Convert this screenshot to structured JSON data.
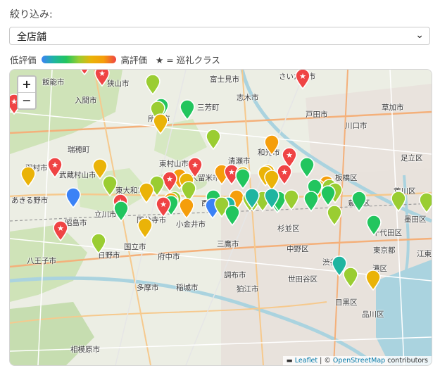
{
  "filter": {
    "label": "絞り込み:",
    "selected": "全店舗"
  },
  "legend": {
    "low": "低評価",
    "high": "高評価",
    "star_note": "★ = 巡礼クラス"
  },
  "map": {
    "zoom_in": "+",
    "zoom_out": "−",
    "attribution": {
      "leaflet": "Leaflet",
      "sep": " | © ",
      "osm": "OpenStreetMap",
      "contrib": " contributors"
    },
    "places": [
      {
        "name": "さいたま市"
      },
      {
        "name": "富士見市"
      },
      {
        "name": "志木市"
      },
      {
        "name": "飯能市"
      },
      {
        "name": "狭山市"
      },
      {
        "name": "入間市"
      },
      {
        "name": "三芳町"
      },
      {
        "name": "戸田市"
      },
      {
        "name": "草加市"
      },
      {
        "name": "川口市"
      },
      {
        "name": "所沢市"
      },
      {
        "name": "和光市"
      },
      {
        "name": "足立区"
      },
      {
        "name": "東村山市"
      },
      {
        "name": "瑞穂町"
      },
      {
        "name": "羽村市"
      },
      {
        "name": "清瀬市"
      },
      {
        "name": "武蔵村山市"
      },
      {
        "name": "東久留米市"
      },
      {
        "name": "板橋区"
      },
      {
        "name": "荒川区"
      },
      {
        "name": "東大和市"
      },
      {
        "name": "西東京市"
      },
      {
        "name": "あきる野市"
      },
      {
        "name": "豊島区"
      },
      {
        "name": "墨田区"
      },
      {
        "name": "立川市"
      },
      {
        "name": "国分寺市"
      },
      {
        "name": "小金井市"
      },
      {
        "name": "杉並区"
      },
      {
        "name": "千代田区"
      },
      {
        "name": "昭島市"
      },
      {
        "name": "国立市"
      },
      {
        "name": "三鷹市"
      },
      {
        "name": "東京都"
      },
      {
        "name": "江東区"
      },
      {
        "name": "八王子市"
      },
      {
        "name": "日野市"
      },
      {
        "name": "府中市"
      },
      {
        "name": "渋谷区"
      },
      {
        "name": "港区"
      },
      {
        "name": "調布市"
      },
      {
        "name": "世田谷区"
      },
      {
        "name": "多摩市"
      },
      {
        "name": "稲城市"
      },
      {
        "name": "狛江市"
      },
      {
        "name": "品川区"
      },
      {
        "name": "目黒区"
      },
      {
        "name": "相模原市"
      },
      {
        "name": "中野区"
      }
    ],
    "markers": [
      {
        "color": "#eab308",
        "star": false
      },
      {
        "color": "#ef4444",
        "star": true
      },
      {
        "color": "#9acd32",
        "star": false
      },
      {
        "color": "#ef4444",
        "star": true
      },
      {
        "color": "#ef4444",
        "star": true
      },
      {
        "color": "#9acd32",
        "star": false
      },
      {
        "color": "#ef4444",
        "star": true
      },
      {
        "color": "#22c55e",
        "star": false
      },
      {
        "color": "#9acd32",
        "star": false
      },
      {
        "color": "#eab308",
        "star": false
      },
      {
        "color": "#22c55e",
        "star": false
      },
      {
        "color": "#9acd32",
        "star": false
      },
      {
        "color": "#f59e0b",
        "star": false
      },
      {
        "color": "#ef4444",
        "star": true
      },
      {
        "color": "#eab308",
        "star": false
      },
      {
        "color": "#ef4444",
        "star": true
      },
      {
        "color": "#f59e0b",
        "star": false
      },
      {
        "color": "#ef4444",
        "star": true
      },
      {
        "color": "#eab308",
        "star": false
      },
      {
        "color": "#eab308",
        "star": false
      },
      {
        "color": "#eab308",
        "star": false
      },
      {
        "color": "#ef4444",
        "star": true
      },
      {
        "color": "#22c55e",
        "star": false
      },
      {
        "color": "#f59e0b",
        "star": false
      },
      {
        "color": "#ef4444",
        "star": true
      },
      {
        "color": "#eab308",
        "star": false
      },
      {
        "color": "#ef4444",
        "star": true
      },
      {
        "color": "#eab308",
        "star": false
      },
      {
        "color": "#9acd32",
        "star": false
      },
      {
        "color": "#9acd32",
        "star": false
      },
      {
        "color": "#f59e0b",
        "star": false
      },
      {
        "color": "#22c55e",
        "star": false
      },
      {
        "color": "#f59e0b",
        "star": false
      },
      {
        "color": "#eab308",
        "star": false
      },
      {
        "color": "#9acd32",
        "star": false
      },
      {
        "color": "#eab308",
        "star": false
      },
      {
        "color": "#9acd32",
        "star": false
      },
      {
        "color": "#3b82f6",
        "star": false
      },
      {
        "color": "#ef4444",
        "star": true
      },
      {
        "color": "#9acd32",
        "star": false
      },
      {
        "color": "#22c55e",
        "star": false
      },
      {
        "color": "#9acd32",
        "star": false
      },
      {
        "color": "#f59e0b",
        "star": false
      },
      {
        "color": "#9acd32",
        "star": false
      },
      {
        "color": "#1fb5a0",
        "star": false
      },
      {
        "color": "#22c55e",
        "star": false
      },
      {
        "color": "#22c55e",
        "star": false
      },
      {
        "color": "#1fb5a0",
        "star": false
      },
      {
        "color": "#3b82f6",
        "star": false
      },
      {
        "color": "#f59e0b",
        "star": false
      },
      {
        "color": "#22c55e",
        "star": false
      },
      {
        "color": "#9acd32",
        "star": false
      },
      {
        "color": "#eab308",
        "star": false
      },
      {
        "color": "#ef4444",
        "star": true
      },
      {
        "color": "#9acd32",
        "star": false
      },
      {
        "color": "#9acd32",
        "star": false
      },
      {
        "color": "#22c55e",
        "star": false
      },
      {
        "color": "#22c55e",
        "star": false
      },
      {
        "color": "#9acd32",
        "star": false
      },
      {
        "color": "#22c55e",
        "star": false
      },
      {
        "color": "#22c55e",
        "star": false
      },
      {
        "color": "#9acd32",
        "star": false
      },
      {
        "color": "#22c55e",
        "star": false
      },
      {
        "color": "#ef4444",
        "star": true
      },
      {
        "color": "#eab308",
        "star": false
      },
      {
        "color": "#9acd32",
        "star": false
      },
      {
        "color": "#22c55e",
        "star": false
      },
      {
        "color": "#1fb5a0",
        "star": false
      },
      {
        "color": "#1fb5a0",
        "star": false
      },
      {
        "color": "#9acd32",
        "star": false
      },
      {
        "color": "#eab308",
        "star": false
      },
      {
        "color": "#22c55e",
        "star": false
      },
      {
        "color": "#9acd32",
        "star": false
      },
      {
        "color": "#9acd32",
        "star": false
      }
    ]
  }
}
